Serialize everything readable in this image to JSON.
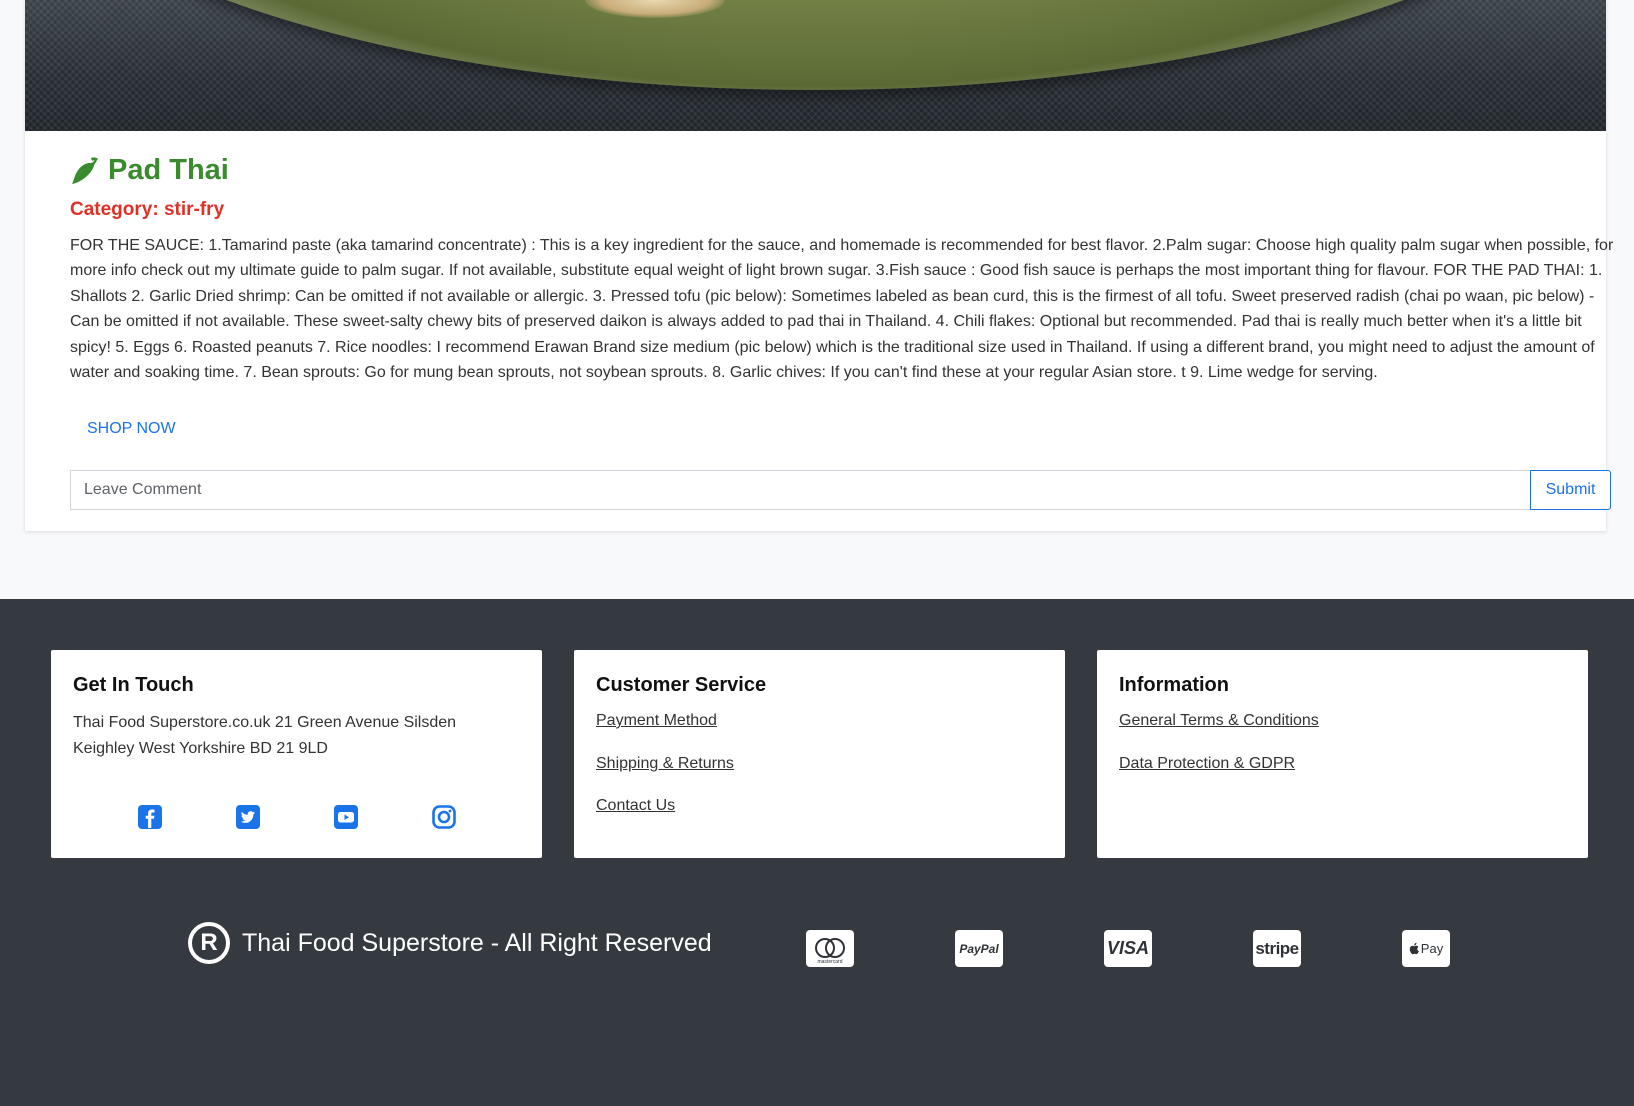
{
  "recipe": {
    "title": "Pad Thai",
    "category": "Category: stir-fry",
    "description": "FOR THE SAUCE: 1.Tamarind paste (aka tamarind concentrate) : This is a key ingredient for the sauce, and homemade is recommended for best flavor. 2.Palm sugar: Choose high quality palm sugar when possible, for more info check out my ultimate guide to palm sugar. If not available, substitute equal weight of light brown sugar. 3.Fish sauce : Good fish sauce is perhaps the most important thing for flavour. FOR THE PAD THAI: 1. Shallots 2. Garlic Dried shrimp: Can be omitted if not available or allergic. 3. Pressed tofu (pic below): Sometimes labeled as bean curd, this is the firmest of all tofu. Sweet preserved radish (chai po waan, pic below) - Can be omitted if not available. These sweet-salty chewy bits of preserved daikon is always added to pad thai in Thailand. 4. Chili flakes: Optional but recommended. Pad thai is really much better when it's a little bit spicy! 5. Eggs 6. Roasted peanuts 7. Rice noodles: I recommend Erawan Brand size medium (pic below) which is the traditional size used in Thailand. If using a different brand, you might need to adjust the amount of water and soaking time. 7. Bean sprouts: Go for mung bean sprouts, not soybean sprouts. 8. Garlic chives: If you can't find these at your regular Asian store. t 9. Lime wedge for serving.",
    "shop_label": "SHOP NOW",
    "icon": "chili-pepper-icon",
    "title_color": "#3a8a2e",
    "category_color": "#e03127"
  },
  "comment": {
    "placeholder": "Leave Comment",
    "value": "",
    "submit_label": "Submit"
  },
  "footer": {
    "get_in_touch": {
      "heading": "Get In Touch",
      "address": "Thai Food Superstore.co.uk 21 Green Avenue Silsden Keighley West Yorkshire BD 21 9LD",
      "social": [
        "facebook-icon",
        "twitter-icon",
        "youtube-icon",
        "instagram-icon"
      ]
    },
    "customer_service": {
      "heading": "Customer Service",
      "links": [
        "Payment Method",
        "Shipping & Returns",
        "Contact Us"
      ]
    },
    "information": {
      "heading": "Information",
      "links": [
        "General Terms & Conditions",
        "Data Protection & GDPR"
      ]
    },
    "copyright": "Thai Food Superstore - All Right Reserved",
    "payment_methods": [
      "mastercard-icon",
      "paypal-icon",
      "visa-icon",
      "stripe-icon",
      "apple-pay-icon"
    ],
    "payment_labels": {
      "mastercard": "mastercard",
      "paypal": "PayPal",
      "visa": "VISA",
      "stripe": "stripe",
      "apple_pay": "Pay"
    },
    "background": "#343a40",
    "accent": "#1a73e8"
  }
}
